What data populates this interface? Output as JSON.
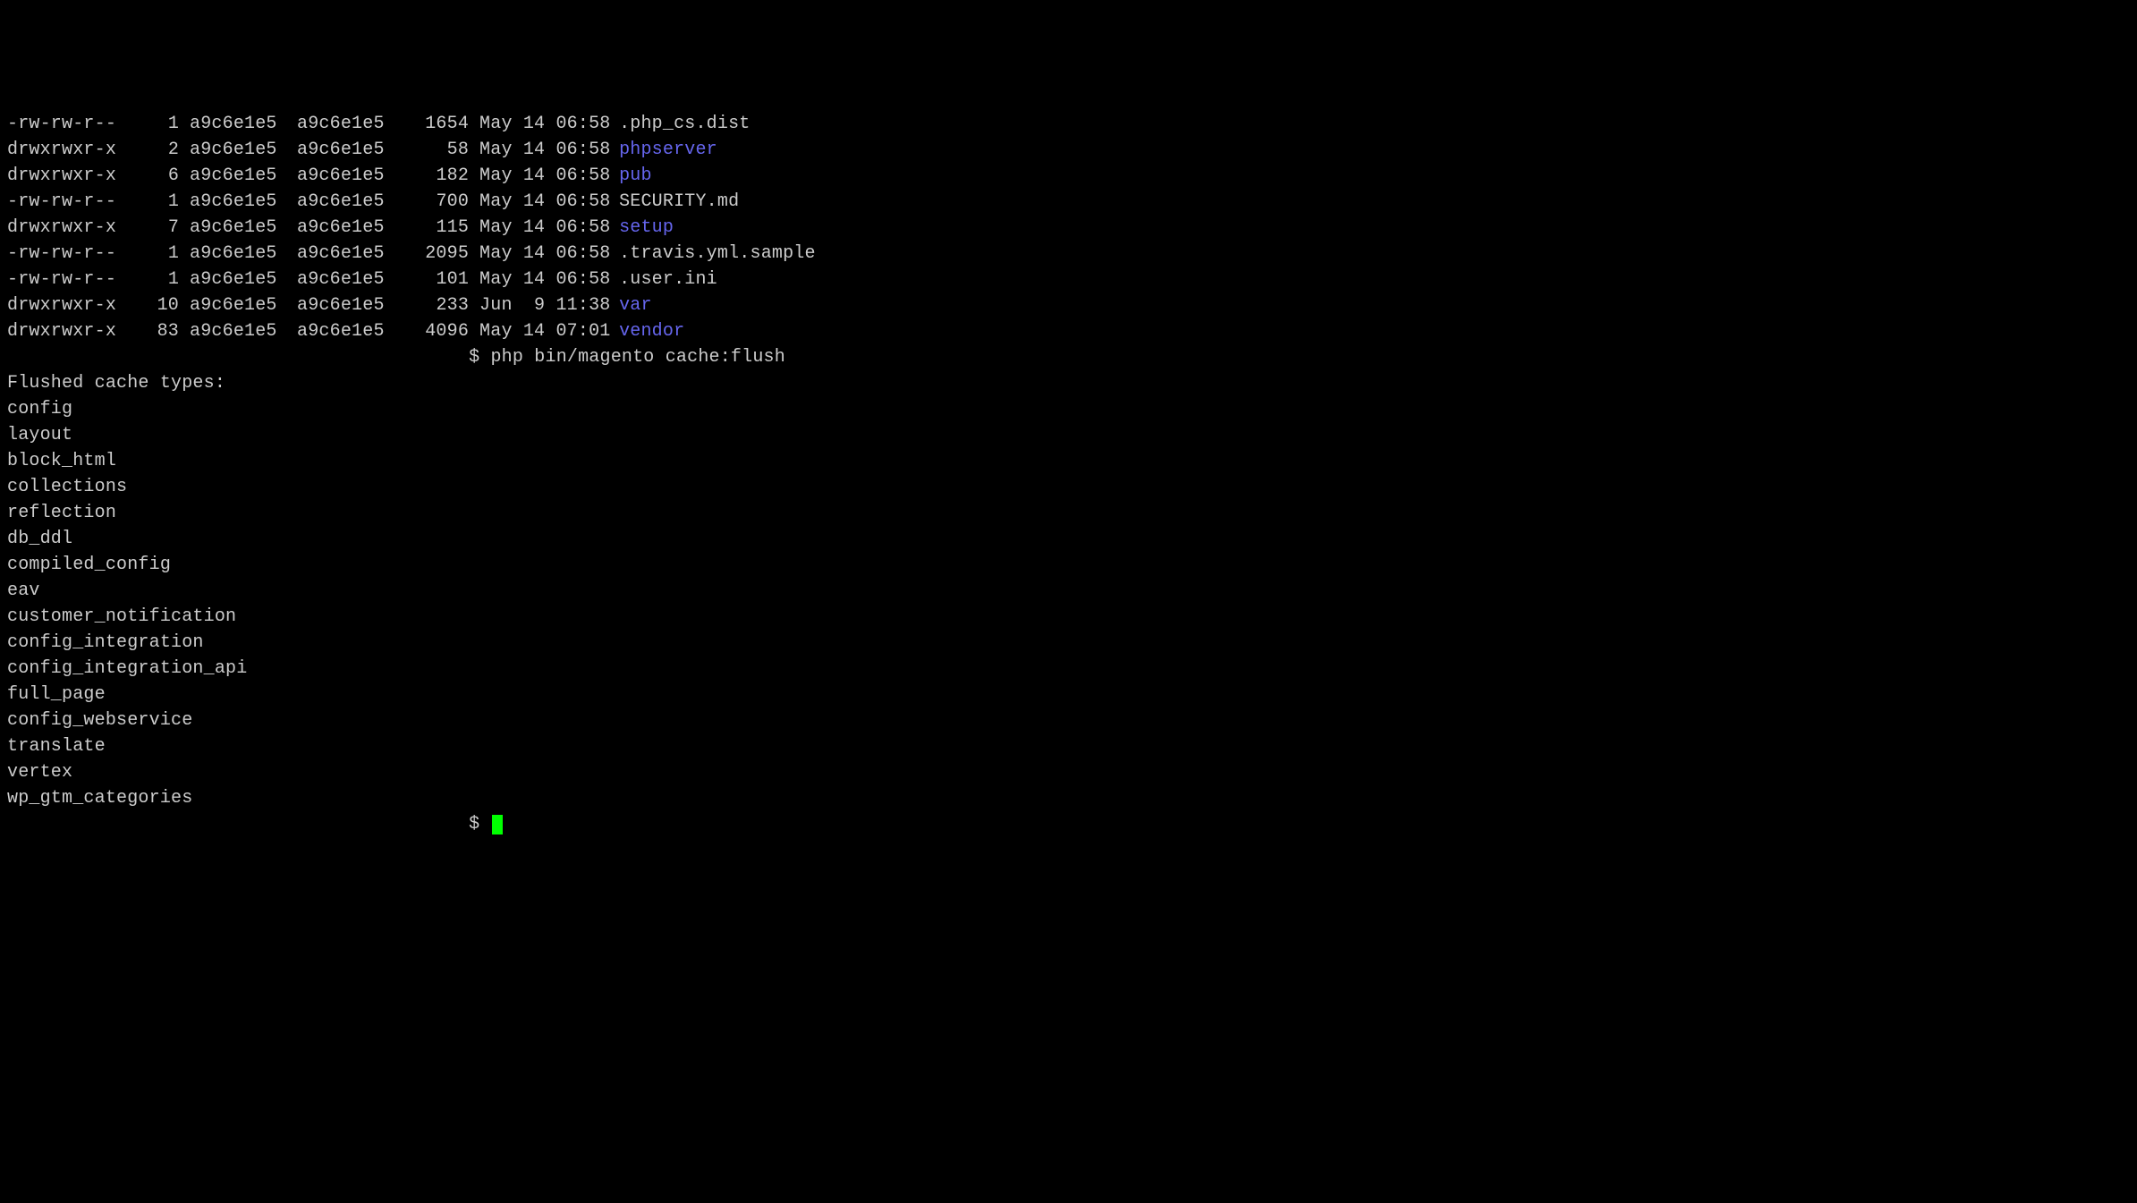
{
  "listing": [
    {
      "perm": "-rw-rw-r--",
      "links": "1",
      "owner": "a9c6e1e5",
      "group": "a9c6e1e5",
      "size": "1654",
      "date": "May 14 06:58",
      "name": ".php_cs.dist",
      "dir": false
    },
    {
      "perm": "drwxrwxr-x",
      "links": "2",
      "owner": "a9c6e1e5",
      "group": "a9c6e1e5",
      "size": "58",
      "date": "May 14 06:58",
      "name": "phpserver",
      "dir": true
    },
    {
      "perm": "drwxrwxr-x",
      "links": "6",
      "owner": "a9c6e1e5",
      "group": "a9c6e1e5",
      "size": "182",
      "date": "May 14 06:58",
      "name": "pub",
      "dir": true
    },
    {
      "perm": "-rw-rw-r--",
      "links": "1",
      "owner": "a9c6e1e5",
      "group": "a9c6e1e5",
      "size": "700",
      "date": "May 14 06:58",
      "name": "SECURITY.md",
      "dir": false
    },
    {
      "perm": "drwxrwxr-x",
      "links": "7",
      "owner": "a9c6e1e5",
      "group": "a9c6e1e5",
      "size": "115",
      "date": "May 14 06:58",
      "name": "setup",
      "dir": true
    },
    {
      "perm": "-rw-rw-r--",
      "links": "1",
      "owner": "a9c6e1e5",
      "group": "a9c6e1e5",
      "size": "2095",
      "date": "May 14 06:58",
      "name": ".travis.yml.sample",
      "dir": false
    },
    {
      "perm": "-rw-rw-r--",
      "links": "1",
      "owner": "a9c6e1e5",
      "group": "a9c6e1e5",
      "size": "101",
      "date": "May 14 06:58",
      "name": ".user.ini",
      "dir": false
    },
    {
      "perm": "drwxrwxr-x",
      "links": "10",
      "owner": "a9c6e1e5",
      "group": "a9c6e1e5",
      "size": "233",
      "date": "Jun  9 11:38",
      "name": "var",
      "dir": true
    },
    {
      "perm": "drwxrwxr-x",
      "links": "83",
      "owner": "a9c6e1e5",
      "group": "a9c6e1e5",
      "size": "4096",
      "date": "May 14 07:01",
      "name": "vendor",
      "dir": true
    }
  ],
  "prompt1": {
    "dollar": "$",
    "cmd": "php bin/magento cache:flush"
  },
  "flush_header": "Flushed cache types:",
  "cache_types": [
    "config",
    "layout",
    "block_html",
    "collections",
    "reflection",
    "db_ddl",
    "compiled_config",
    "eav",
    "customer_notification",
    "config_integration",
    "config_integration_api",
    "full_page",
    "config_webservice",
    "translate",
    "vertex",
    "wp_gtm_categories"
  ],
  "prompt2": {
    "dollar": "$"
  }
}
